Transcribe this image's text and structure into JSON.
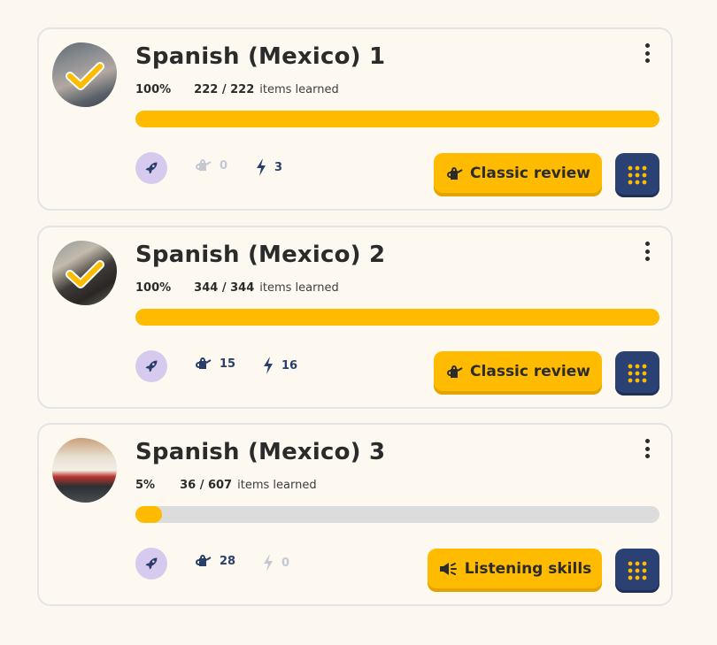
{
  "items_learned_label": "items learned",
  "courses": [
    {
      "title": "Spanish (Mexico) 1",
      "percent": "100%",
      "items": "222 / 222",
      "progress_fraction": 1.0,
      "completed": true,
      "watering_count": "0",
      "speed_count": "3",
      "watering_active": false,
      "speed_active": true,
      "mode_label": "Classic review",
      "mode_icon": "watering-can-icon"
    },
    {
      "title": "Spanish (Mexico) 2",
      "percent": "100%",
      "items": "344 / 344",
      "progress_fraction": 1.0,
      "completed": true,
      "watering_count": "15",
      "speed_count": "16",
      "watering_active": true,
      "speed_active": true,
      "mode_label": "Classic review",
      "mode_icon": "watering-can-icon"
    },
    {
      "title": "Spanish (Mexico) 3",
      "percent": "5%",
      "items": "36 / 607",
      "progress_fraction": 0.05,
      "completed": false,
      "watering_count": "28",
      "speed_count": "0",
      "watering_active": true,
      "speed_active": false,
      "mode_label": "Listening skills",
      "mode_icon": "megaphone-icon"
    }
  ],
  "colors": {
    "accent": "#ffbb00",
    "navy": "#2b4173",
    "rocket_bg": "#d6cbef",
    "muted": "#c3c8d3"
  }
}
